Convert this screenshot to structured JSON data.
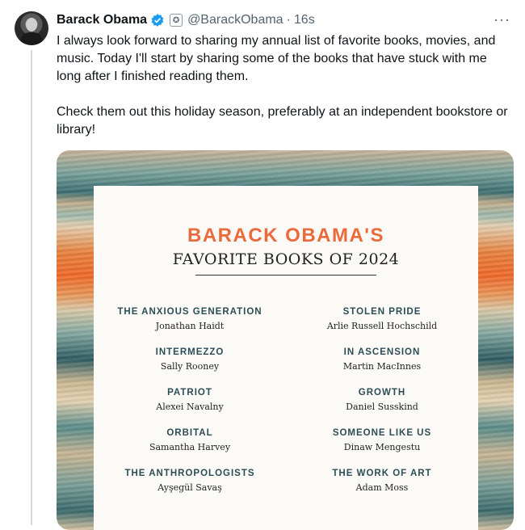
{
  "tweet": {
    "name": "Barack Obama",
    "handle": "@BarackObama",
    "separator": "·",
    "time": "16s",
    "more": "···",
    "paragraphs": [
      "I always look forward to sharing my annual list of favorite books, movies, and music. Today I'll start by sharing some of the books that have stuck with me long after I finished reading them.",
      "Check them out this holiday season, preferably at an independent bookstore or library!"
    ]
  },
  "icons": {
    "verified": "verified-badge-icon",
    "affiliation": "government-seal-icon",
    "more": "more-options-icon"
  },
  "colors": {
    "verified": "#1d9bf0",
    "title_orange": "#ea6a3b",
    "book_title": "#2c4d56"
  },
  "card": {
    "title": "BARACK OBAMA'S",
    "subtitle": "FAVORITE BOOKS OF 2024",
    "books": [
      {
        "title": "THE ANXIOUS GENERATION",
        "author": "Jonathan Haidt"
      },
      {
        "title": "STOLEN PRIDE",
        "author": "Arlie Russell Hochschild"
      },
      {
        "title": "INTERMEZZO",
        "author": "Sally Rooney"
      },
      {
        "title": "IN ASCENSION",
        "author": "Martin MacInnes"
      },
      {
        "title": "PATRIOT",
        "author": "Alexei Navalny"
      },
      {
        "title": "GROWTH",
        "author": "Daniel Susskind"
      },
      {
        "title": "ORBITAL",
        "author": "Samantha Harvey"
      },
      {
        "title": "SOMEONE LIKE US",
        "author": "Dinaw Mengestu"
      },
      {
        "title": "THE ANTHROPOLOGISTS",
        "author": "Ayşegül Savaş"
      },
      {
        "title": "THE WORK OF ART",
        "author": "Adam Moss"
      }
    ]
  }
}
